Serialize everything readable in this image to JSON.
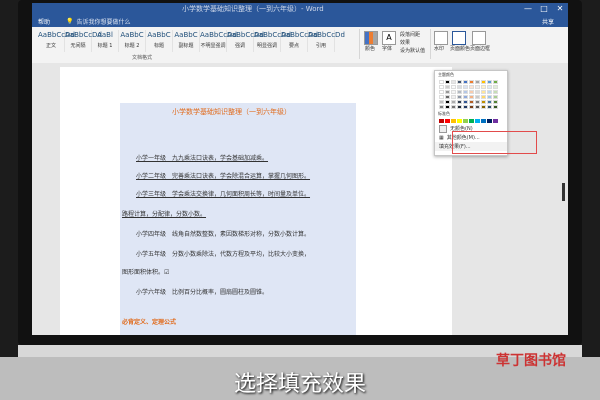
{
  "window": {
    "title": "小学数学基础知识整理（一到六年级）- Word",
    "minimize": "—",
    "maximize": "□",
    "close": "✕"
  },
  "menubar": {
    "help": "帮助",
    "tellme": "告诉我你想要做什么",
    "share": "共享"
  },
  "ribbon": {
    "styles": [
      {
        "preview": "AaBbCcDd",
        "name": "正文"
      },
      {
        "preview": "AaBbCcDd",
        "name": "无间隔"
      },
      {
        "preview": "AaBl",
        "name": "标题 1"
      },
      {
        "preview": "AaBbC",
        "name": "标题 2"
      },
      {
        "preview": "AaBbC",
        "name": "标题"
      },
      {
        "preview": "AaBbC",
        "name": "副标题"
      },
      {
        "preview": "AaBbCcDd",
        "name": "不明显强调"
      },
      {
        "preview": "AaBbCcDd",
        "name": "强调"
      },
      {
        "preview": "AaBbCcDd",
        "name": "明显强调"
      },
      {
        "preview": "AaBbCcDd",
        "name": "要点"
      },
      {
        "preview": "AaBbCcDd",
        "name": "引用"
      }
    ],
    "group_label": "文档格式",
    "colors_label": "颜色",
    "fonts_label": "字体",
    "paragraph_spacing": "段落间距",
    "effects": "效果",
    "set_default": "设为默认值",
    "watermark": "水印",
    "page_color": "页面颜色",
    "page_borders": "页面边框"
  },
  "dropdown": {
    "theme_colors_label": "主题颜色",
    "standard_colors_label": "标准色",
    "no_color": "无颜色(N)",
    "other_colors": "其他颜色(M)...",
    "fill_effects": "填充效果(F)...",
    "theme_colors": [
      "#ffffff",
      "#000000",
      "#e7e6e6",
      "#44546a",
      "#4472c4",
      "#ed7d31",
      "#a5a5a5",
      "#ffc000",
      "#5b9bd5",
      "#70ad47"
    ],
    "standard_colors": [
      "#c00000",
      "#ff0000",
      "#ffc000",
      "#ffff00",
      "#92d050",
      "#00b050",
      "#00b0f0",
      "#0070c0",
      "#002060",
      "#7030a0"
    ]
  },
  "document": {
    "title": "小学数学基础知识整理（一到六年级）",
    "paragraphs": [
      "小学一年级　九九乘法口诀表，学会基础加减乘。",
      "小学二年级　完善乘法口诀表，学会除混合运算，掌握几何图形。",
      "小学三年级　学会乘法交换律，几何面积周长等，时间量及单位。",
      "路程计算，分配律，分数小数。",
      "小学四年级　线角自然数整数，素因数梯形对称，分数小数计算。",
      "小学五年级　分数小数乘除法，代数方程及平均，比较大小变换，",
      "图形面积体积。☑",
      "小学六年级　比例百分比概率，圆扇圆柱及圆锥。"
    ],
    "section_heading": "必背定义、定理公式"
  },
  "caption": "选择填充效果",
  "logo": {
    "text": "草丁图书馆"
  }
}
